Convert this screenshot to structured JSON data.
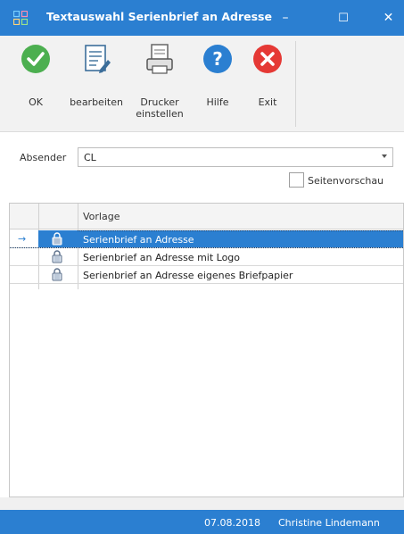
{
  "window": {
    "title": "Textauswahl Serienbrief an Adresse",
    "app_icon": "grid-app-icon",
    "controls": {
      "minimize": "–",
      "maximize": "☐",
      "close": "✕"
    },
    "accent_color": "#2b7fd1"
  },
  "toolbar": {
    "buttons": [
      {
        "id": "ok",
        "label": "OK",
        "icon": "checkmark-circle-icon",
        "color": "#4caf50"
      },
      {
        "id": "edit",
        "label": "bearbeiten",
        "icon": "document-edit-icon",
        "color": "#3c6e9a"
      },
      {
        "id": "printer",
        "label": "Drucker\neinstellen",
        "icon": "printer-page-icon",
        "color": "#555555"
      },
      {
        "id": "help",
        "label": "Hilfe",
        "icon": "help-circle-icon",
        "color": "#2b7fd1"
      },
      {
        "id": "exit",
        "label": "Exit",
        "icon": "close-circle-icon",
        "color": "#e53935"
      }
    ]
  },
  "form": {
    "absender_label": "Absender",
    "absender_value": "CL",
    "preview_label": "Seitenvorschau",
    "preview_checked": false
  },
  "grid": {
    "column_header": "Vorlage",
    "rows": [
      {
        "text": "Serienbrief an Adresse",
        "selected": true,
        "icon": "lock-icon"
      },
      {
        "text": "Serienbrief an Adresse mit Logo",
        "selected": false,
        "icon": "lock-icon"
      },
      {
        "text": "Serienbrief an Adresse eigenes Briefpapier",
        "selected": false,
        "icon": "lock-icon"
      }
    ],
    "current_row_indicator": "→"
  },
  "status": {
    "date": "07.08.2018",
    "user": "Christine Lindemann"
  }
}
